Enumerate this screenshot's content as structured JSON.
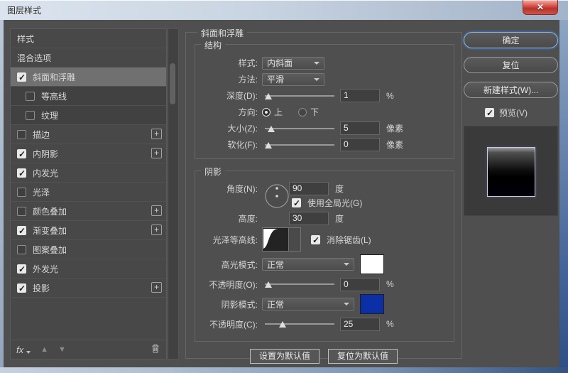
{
  "window": {
    "title": "图层样式",
    "close": "✕"
  },
  "sidebar": {
    "items": [
      {
        "label": "样式"
      },
      {
        "label": "混合选项"
      },
      {
        "label": "斜面和浮雕",
        "checked": true,
        "selected": true
      },
      {
        "label": "等高线",
        "checked": false,
        "sub": true
      },
      {
        "label": "纹理",
        "checked": false,
        "sub": true
      },
      {
        "label": "描边",
        "checked": false,
        "plus": true
      },
      {
        "label": "内阴影",
        "checked": true,
        "plus": true
      },
      {
        "label": "内发光",
        "checked": true
      },
      {
        "label": "光泽",
        "checked": false
      },
      {
        "label": "颜色叠加",
        "checked": false,
        "plus": true
      },
      {
        "label": "渐变叠加",
        "checked": true,
        "plus": true
      },
      {
        "label": "图案叠加",
        "checked": false
      },
      {
        "label": "外发光",
        "checked": true
      },
      {
        "label": "投影",
        "checked": true,
        "plus": true
      }
    ],
    "toolbar": {
      "fx_label": "fx"
    }
  },
  "panel": {
    "title": "斜面和浮雕",
    "structure": {
      "legend": "结构",
      "style_label": "样式:",
      "style_value": "内斜面",
      "technique_label": "方法:",
      "technique_value": "平滑",
      "depth_label": "深度(D):",
      "depth_value": "1",
      "depth_unit": "%",
      "direction_label": "方向:",
      "direction_up": "上",
      "direction_down": "下",
      "size_label": "大小(Z):",
      "size_value": "5",
      "size_unit": "像素",
      "soften_label": "软化(F):",
      "soften_value": "0",
      "soften_unit": "像素"
    },
    "shading": {
      "legend": "阴影",
      "angle_label": "角度(N):",
      "angle_value": "90",
      "angle_unit": "度",
      "global_light_label": "使用全局光(G)",
      "global_light_checked": true,
      "altitude_label": "高度:",
      "altitude_value": "30",
      "altitude_unit": "度",
      "gloss_contour_label": "光泽等高线:",
      "anti_alias_label": "消除锯齿(L)",
      "anti_alias_checked": true,
      "highlight_mode_label": "高光模式:",
      "highlight_mode_value": "正常",
      "highlight_color": "#ffffff",
      "opacity_highlight_label": "不透明度(O):",
      "opacity_highlight_value": "0",
      "opacity_highlight_unit": "%",
      "shadow_mode_label": "阴影模式:",
      "shadow_mode_value": "正常",
      "shadow_color": "#0a2fa6",
      "opacity_shadow_label": "不透明度(C):",
      "opacity_shadow_value": "25",
      "opacity_shadow_unit": "%"
    },
    "footer_buttons": {
      "set_default": "设置为默认值",
      "reset_default": "复位为默认值"
    }
  },
  "actions": {
    "ok": "确定",
    "reset": "复位",
    "new_style": "新建样式(W)...",
    "preview_label": "预览(V)",
    "preview_checked": true
  }
}
